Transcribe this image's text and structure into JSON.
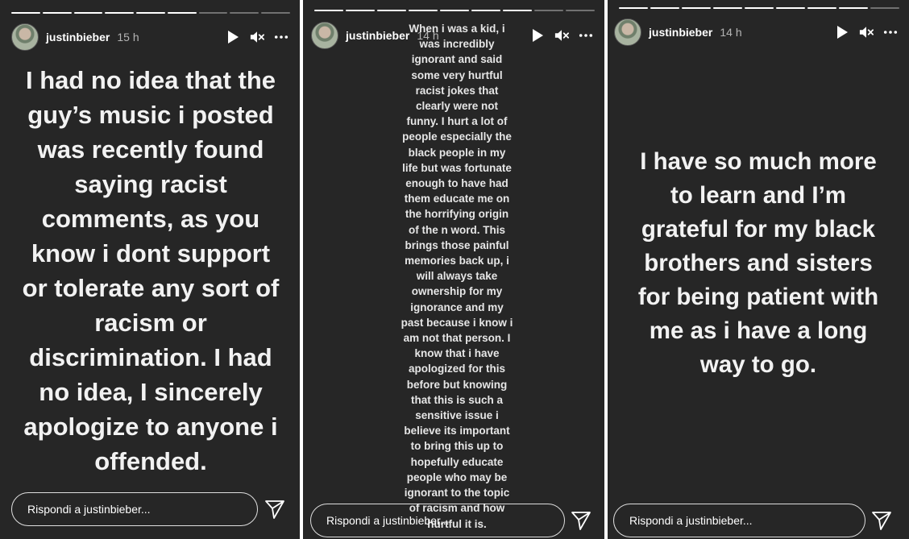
{
  "colors": {
    "background": "#262626",
    "text": "#ffffff",
    "divider": "#ffffff"
  },
  "icons": [
    "play-icon",
    "mute-icon",
    "more-icon",
    "send-icon"
  ],
  "panels": [
    {
      "username": "justinbieber",
      "time": "15 h",
      "progress_done": 6,
      "progress_total": 9,
      "text": "I had no idea that the\nguy’s music i posted\nwas recently found\nsaying  racist\ncomments, as you\nknow i dont support\nor tolerate any sort of\nracism or\ndiscrimination. I had\nno idea, I sincerely\napologize to anyone i\noffended.",
      "reply_placeholder": "Rispondi a justinbieber..."
    },
    {
      "username": "justinbieber",
      "time": "14 h",
      "progress_done": 7,
      "progress_total": 9,
      "text": "When i was a kid, i\nwas incredibly\nignorant and said\nsome very hurtful\nracist jokes that\nclearly were not\nfunny. I hurt a lot of\npeople especially the\nblack people in my\nlife but was fortunate\nenough to have had\nthem educate me on\nthe horrifying origin\nof the n word.  This\nbrings those painful\nmemories back up, i\nwill always take\nownership for my\nignorance and my\npast because i know i\nam not that person. I\nknow that i have\napologized for this\nbefore but knowing\nthat this is such a\nsensitive issue i\nbelieve its important\nto bring this up to\nhopefully educate\npeople who may be\nignorant to the topic\nof racism and how\nhurtful it is.",
      "reply_placeholder": "Rispondi a justinbieber..."
    },
    {
      "username": "justinbieber",
      "time": "14 h",
      "progress_done": 8,
      "progress_total": 9,
      "text": "I have so much more\nto learn and I’m\ngrateful for my black\nbrothers and sisters\nfor being patient with\nme as i have a long\nway to go.",
      "reply_placeholder": "Rispondi a justinbieber..."
    }
  ]
}
